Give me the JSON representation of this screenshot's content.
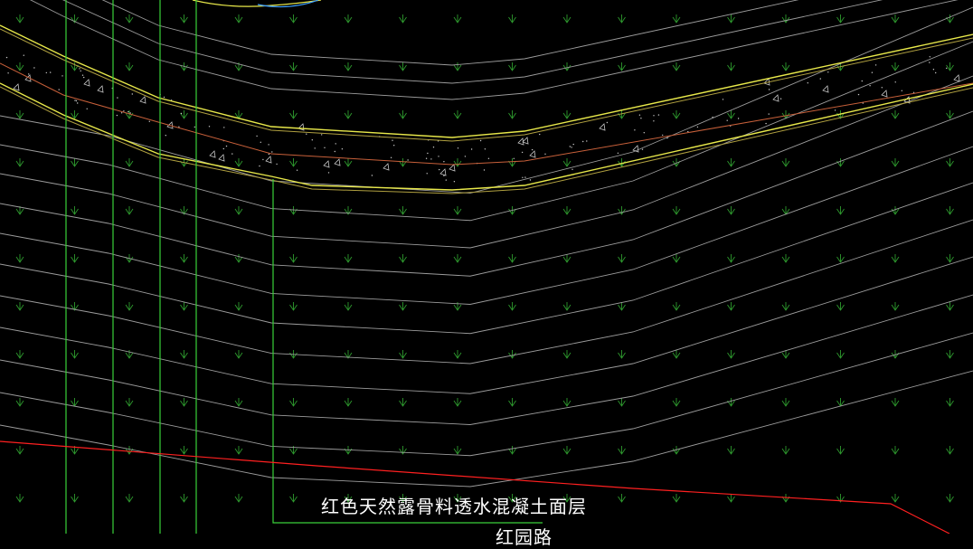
{
  "drawing": {
    "background": "#000000",
    "colors": {
      "road_edge": "#e8e84a",
      "road_center": "#c8603a",
      "contour": "#9c9c9c",
      "grid_green": "#39d039",
      "grass_symbol": "#2e9a2e",
      "red_boundary": "#ff2020",
      "hatch": "#c8c8c8",
      "cyan_curve": "#3fa0ff",
      "text": "#ffffff"
    }
  },
  "annotations": {
    "material_label": "红色天然露骨料透水混凝土面层",
    "partial_label": "红园路"
  }
}
